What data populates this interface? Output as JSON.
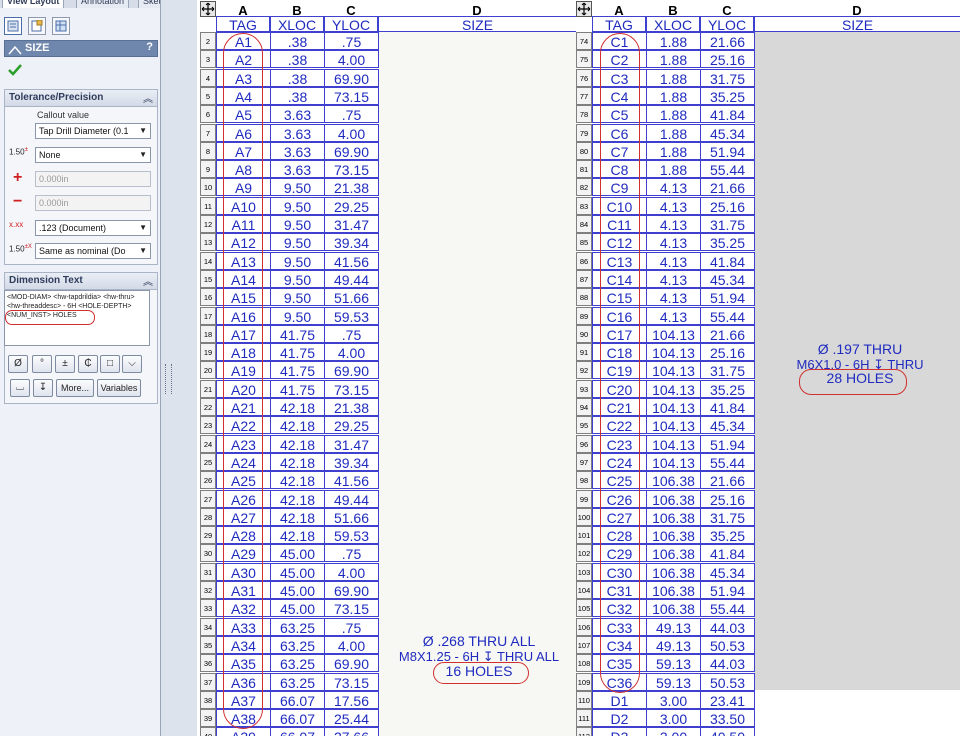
{
  "panel": {
    "tabs": [
      "View Layout",
      "Annotation",
      "Sketch"
    ],
    "title": "SIZE",
    "help": "?",
    "tolerance": {
      "header": "Tolerance/Precision",
      "callout_label": "Callout value",
      "callout_value": "Tap Drill Diameter (0.1",
      "tolerance_type": "None",
      "plus_value": "0.000in",
      "minus_value": "0.000in",
      "precision": ".123 (Document)",
      "tol_precision": "Same as nominal (Do",
      "icon_labels": [
        "1.50",
        "+0.01",
        "-0.01",
        "x.xxx",
        "1.50",
        "+0.1X",
        "-.XX"
      ]
    },
    "dimension_text": {
      "header": "Dimension Text",
      "lines": [
        "<MOD-DIAM> <hw-tapdrildia> <hw-thru>",
        "<hw-threaddesc> - 6H <HOLE-DEPTH>",
        "<NUM_INST> HOLES"
      ],
      "symbol_buttons": [
        "Ø",
        "°",
        "±",
        "₵",
        "□",
        "⌵",
        "⌴",
        "↧"
      ],
      "more_label": "More...",
      "variables_label": "Variables"
    }
  },
  "sheet_left": {
    "columns": [
      "A",
      "B",
      "C",
      "D"
    ],
    "headers": [
      "TAG",
      "XLOC",
      "YLOC",
      "SIZE"
    ],
    "rows": [
      [
        "A1",
        ".38",
        ".75"
      ],
      [
        "A2",
        ".38",
        "4.00"
      ],
      [
        "A3",
        ".38",
        "69.90"
      ],
      [
        "A4",
        ".38",
        "73.15"
      ],
      [
        "A5",
        "3.63",
        ".75"
      ],
      [
        "A6",
        "3.63",
        "4.00"
      ],
      [
        "A7",
        "3.63",
        "69.90"
      ],
      [
        "A8",
        "3.63",
        "73.15"
      ],
      [
        "A9",
        "9.50",
        "21.38"
      ],
      [
        "A10",
        "9.50",
        "29.25"
      ],
      [
        "A11",
        "9.50",
        "31.47"
      ],
      [
        "A12",
        "9.50",
        "39.34"
      ],
      [
        "A13",
        "9.50",
        "41.56"
      ],
      [
        "A14",
        "9.50",
        "49.44"
      ],
      [
        "A15",
        "9.50",
        "51.66"
      ],
      [
        "A16",
        "9.50",
        "59.53"
      ],
      [
        "A17",
        "41.75",
        ".75"
      ],
      [
        "A18",
        "41.75",
        "4.00"
      ],
      [
        "A19",
        "41.75",
        "69.90"
      ],
      [
        "A20",
        "41.75",
        "73.15"
      ],
      [
        "A21",
        "42.18",
        "21.38"
      ],
      [
        "A22",
        "42.18",
        "29.25"
      ],
      [
        "A23",
        "42.18",
        "31.47"
      ],
      [
        "A24",
        "42.18",
        "39.34"
      ],
      [
        "A25",
        "42.18",
        "41.56"
      ],
      [
        "A26",
        "42.18",
        "49.44"
      ],
      [
        "A27",
        "42.18",
        "51.66"
      ],
      [
        "A28",
        "42.18",
        "59.53"
      ],
      [
        "A29",
        "45.00",
        ".75"
      ],
      [
        "A30",
        "45.00",
        "4.00"
      ],
      [
        "A31",
        "45.00",
        "69.90"
      ],
      [
        "A32",
        "45.00",
        "73.15"
      ],
      [
        "A33",
        "63.25",
        ".75"
      ],
      [
        "A34",
        "63.25",
        "4.00"
      ],
      [
        "A35",
        "63.25",
        "69.90"
      ],
      [
        "A36",
        "63.25",
        "73.15"
      ],
      [
        "A37",
        "66.07",
        "17.56"
      ],
      [
        "A38",
        "66.07",
        "25.44"
      ],
      [
        "A39",
        "66.07",
        "27.66"
      ]
    ],
    "row_numbers": [
      "2",
      "3",
      "4",
      "5",
      "6",
      "7",
      "8",
      "9",
      "10",
      "11",
      "12",
      "13",
      "14",
      "15",
      "16",
      "17",
      "18",
      "19",
      "20",
      "21",
      "22",
      "23",
      "24",
      "25",
      "26",
      "27",
      "28",
      "29",
      "30",
      "31",
      "32",
      "33",
      "34",
      "35",
      "36",
      "37",
      "38",
      "39",
      "40"
    ],
    "note": [
      "Ø .268 THRU ALL",
      "M8X1.25 - 6H ↧ THRU ALL",
      "16 HOLES"
    ]
  },
  "sheet_right": {
    "columns": [
      "A",
      "B",
      "C",
      "D"
    ],
    "headers": [
      "TAG",
      "XLOC",
      "YLOC",
      "SIZE"
    ],
    "rows": [
      [
        "C1",
        "1.88",
        "21.66"
      ],
      [
        "C2",
        "1.88",
        "25.16"
      ],
      [
        "C3",
        "1.88",
        "31.75"
      ],
      [
        "C4",
        "1.88",
        "35.25"
      ],
      [
        "C5",
        "1.88",
        "41.84"
      ],
      [
        "C6",
        "1.88",
        "45.34"
      ],
      [
        "C7",
        "1.88",
        "51.94"
      ],
      [
        "C8",
        "1.88",
        "55.44"
      ],
      [
        "C9",
        "4.13",
        "21.66"
      ],
      [
        "C10",
        "4.13",
        "25.16"
      ],
      [
        "C11",
        "4.13",
        "31.75"
      ],
      [
        "C12",
        "4.13",
        "35.25"
      ],
      [
        "C13",
        "4.13",
        "41.84"
      ],
      [
        "C14",
        "4.13",
        "45.34"
      ],
      [
        "C15",
        "4.13",
        "51.94"
      ],
      [
        "C16",
        "4.13",
        "55.44"
      ],
      [
        "C17",
        "104.13",
        "21.66"
      ],
      [
        "C18",
        "104.13",
        "25.16"
      ],
      [
        "C19",
        "104.13",
        "31.75"
      ],
      [
        "C20",
        "104.13",
        "35.25"
      ],
      [
        "C21",
        "104.13",
        "41.84"
      ],
      [
        "C22",
        "104.13",
        "45.34"
      ],
      [
        "C23",
        "104.13",
        "51.94"
      ],
      [
        "C24",
        "104.13",
        "55.44"
      ],
      [
        "C25",
        "106.38",
        "21.66"
      ],
      [
        "C26",
        "106.38",
        "25.16"
      ],
      [
        "C27",
        "106.38",
        "31.75"
      ],
      [
        "C28",
        "106.38",
        "35.25"
      ],
      [
        "C29",
        "106.38",
        "41.84"
      ],
      [
        "C30",
        "106.38",
        "45.34"
      ],
      [
        "C31",
        "106.38",
        "51.94"
      ],
      [
        "C32",
        "106.38",
        "55.44"
      ],
      [
        "C33",
        "49.13",
        "44.03"
      ],
      [
        "C34",
        "49.13",
        "50.53"
      ],
      [
        "C35",
        "59.13",
        "44.03"
      ],
      [
        "C36",
        "59.13",
        "50.53"
      ],
      [
        "D1",
        "3.00",
        "23.41"
      ],
      [
        "D2",
        "3.00",
        "33.50"
      ],
      [
        "D3",
        "3.00",
        "40.50"
      ]
    ],
    "row_numbers": [
      "74",
      "75",
      "76",
      "77",
      "78",
      "79",
      "80",
      "81",
      "82",
      "83",
      "84",
      "85",
      "86",
      "87",
      "88",
      "89",
      "90",
      "91",
      "92",
      "93",
      "94",
      "95",
      "96",
      "97",
      "98",
      "99",
      "100",
      "101",
      "102",
      "103",
      "104",
      "105",
      "106",
      "107",
      "108",
      "109",
      "110",
      "111",
      "112"
    ],
    "note": [
      "Ø .197 THRU",
      "M6X1.0 - 6H ↧ THRU",
      "28 HOLES"
    ]
  },
  "colors": {
    "cell_text": "#1f2bbf",
    "grid": "#3f3fd0",
    "highlight": "#d03030",
    "shaded": "#d8d8d8"
  }
}
